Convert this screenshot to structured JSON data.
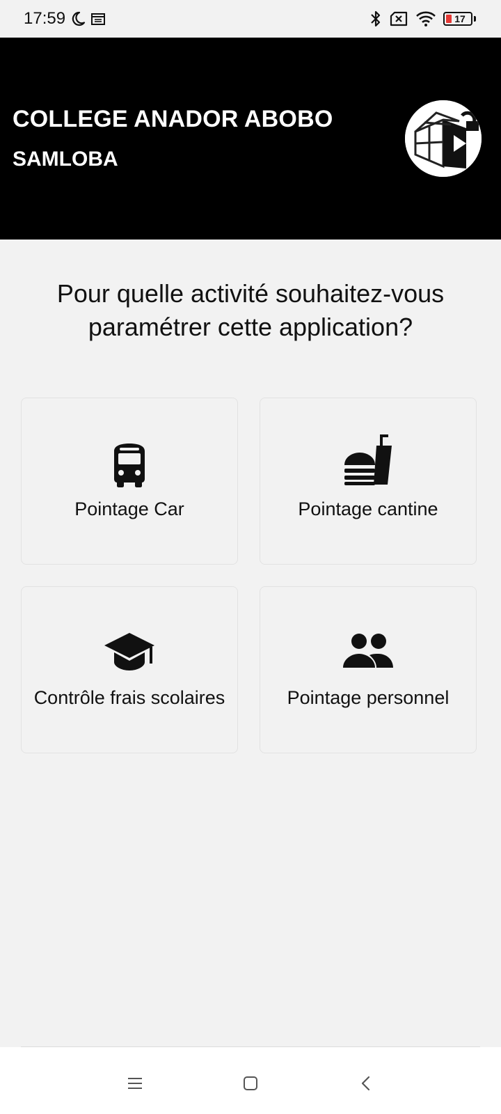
{
  "status_bar": {
    "time": "17:59",
    "battery_level": "17",
    "icons": [
      "moon-icon",
      "calendar-icon",
      "bluetooth-icon",
      "sim-off-icon",
      "wifi-icon",
      "battery-icon"
    ],
    "battery_low_color": "#e53935"
  },
  "header": {
    "title": "COLLEGE ANADOR ABOBO",
    "subtitle": "SAMLOBA",
    "background": "#000000",
    "logo_icon": "cube-logo"
  },
  "main": {
    "question": "Pour quelle activité souhaitez-vous paramétrer cette application?",
    "cards": [
      {
        "label": "Pointage Car",
        "icon": "bus-icon"
      },
      {
        "label": "Pointage cantine",
        "icon": "fastfood-icon"
      },
      {
        "label": "Contrôle frais scolaires",
        "icon": "graduation-cap-icon"
      },
      {
        "label": "Pointage personnel",
        "icon": "people-icon"
      }
    ]
  },
  "nav_bar": {
    "buttons": [
      "menu-icon",
      "home-square-icon",
      "back-chevron-icon"
    ]
  }
}
